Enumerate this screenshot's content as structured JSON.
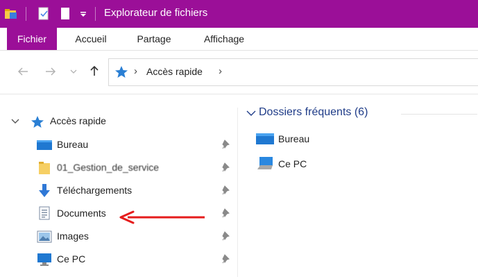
{
  "window": {
    "title": "Explorateur de fichiers"
  },
  "ribbon": {
    "tabs": [
      "Fichier",
      "Accueil",
      "Partage",
      "Affichage"
    ]
  },
  "address": {
    "separator": "›",
    "path": "Accès rapide",
    "trail": "›"
  },
  "nav": {
    "header": "Accès rapide",
    "items": [
      {
        "label": "Bureau",
        "icon": "desktop-icon"
      },
      {
        "label": "01_Gestion_de_service",
        "icon": "folder-icon"
      },
      {
        "label": "Téléchargements",
        "icon": "download-icon"
      },
      {
        "label": "Documents",
        "icon": "document-icon"
      },
      {
        "label": "Images",
        "icon": "image-icon"
      },
      {
        "label": "Ce PC",
        "icon": "computer-icon"
      }
    ]
  },
  "content": {
    "group_title": "Dossiers fréquents (6)",
    "items": [
      {
        "label": "Bureau",
        "icon": "desktop-icon"
      },
      {
        "label": "Ce PC",
        "icon": "computer-icon"
      }
    ]
  },
  "colors": {
    "titlebar": "#9b0f98",
    "accent_blue": "#1e88e5",
    "annotation_arrow": "#e51c1c"
  }
}
